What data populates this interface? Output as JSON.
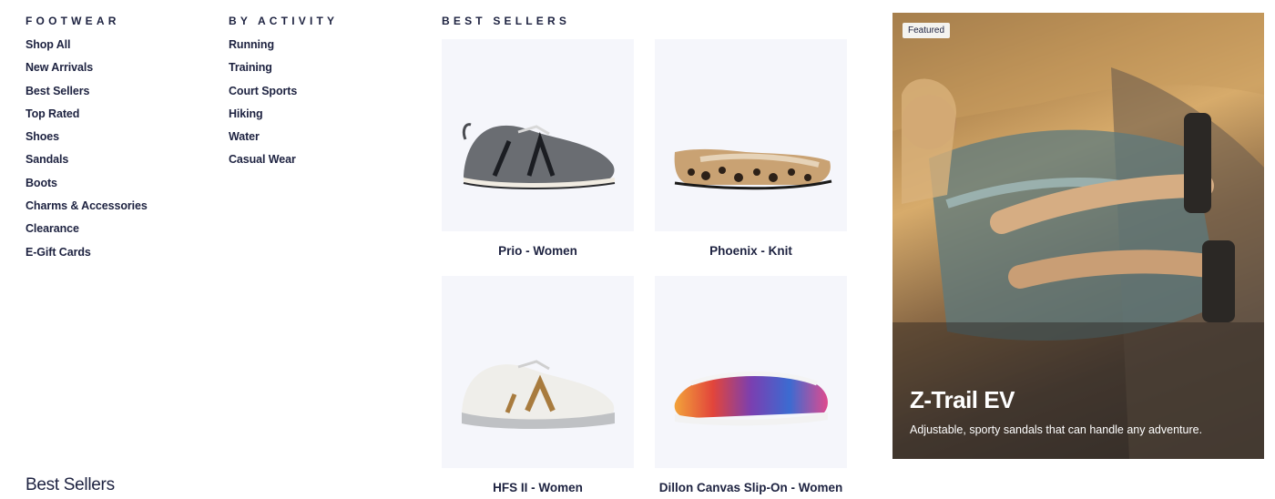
{
  "footwear": {
    "heading": "FOOTWEAR",
    "links": [
      "Shop All",
      "New Arrivals",
      "Best Sellers",
      "Top Rated",
      "Shoes",
      "Sandals",
      "Boots",
      "Charms & Accessories",
      "Clearance",
      "E-Gift Cards"
    ]
  },
  "activity": {
    "heading": "BY ACTIVITY",
    "links": [
      "Running",
      "Training",
      "Court Sports",
      "Hiking",
      "Water",
      "Casual Wear"
    ]
  },
  "best_sellers": {
    "heading": "BEST SELLERS",
    "products": [
      {
        "name": "Prio - Women",
        "icon": "gray-sneaker-icon"
      },
      {
        "name": "Phoenix - Knit",
        "icon": "leopard-flat-icon"
      },
      {
        "name": "HFS II - Women",
        "icon": "white-sneaker-icon"
      },
      {
        "name": "Dillon Canvas Slip-On - Women",
        "icon": "tie-dye-slip-on-icon"
      }
    ]
  },
  "promo": {
    "badge": "Featured",
    "title": "Z-Trail EV",
    "description": "Adjustable, sporty sandals that can handle any adventure."
  },
  "bottom": {
    "title": "Best Sellers"
  },
  "colors": {
    "text": "#1d2240",
    "card_bg": "#f5f6fb"
  }
}
